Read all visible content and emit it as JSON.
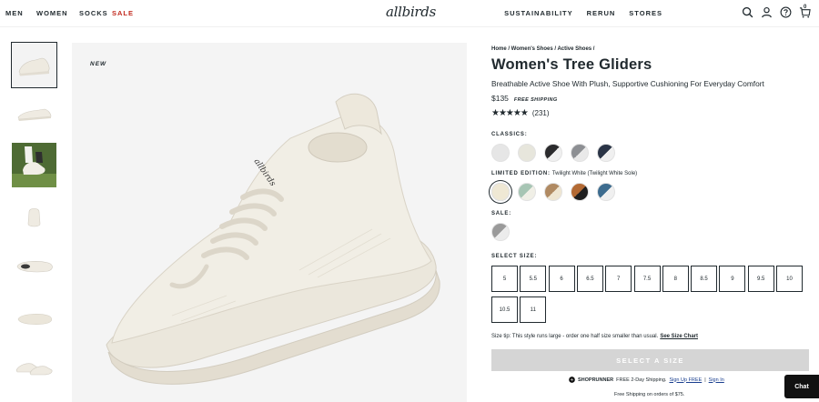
{
  "header": {
    "nav_left": [
      {
        "label": "MEN"
      },
      {
        "label": "WOMEN"
      },
      {
        "label": "SOCKS"
      },
      {
        "label": "SALE"
      }
    ],
    "logo": "allbirds",
    "nav_right": [
      {
        "label": "SUSTAINABILITY"
      },
      {
        "label": "RERUN"
      },
      {
        "label": "STORES"
      }
    ],
    "icons": [
      "search-icon",
      "account-icon",
      "help-icon",
      "cart-icon"
    ],
    "cart_count": "0"
  },
  "gallery": {
    "badge": "NEW",
    "thumbnail_count": 7
  },
  "product": {
    "breadcrumb": "Home / Women's Shoes / Active Shoes /",
    "title": "Women's Tree Gliders",
    "subtitle": "Breathable Active Shoe With Plush, Supportive Cushioning For Everyday Comfort",
    "price": "$135",
    "shipping_badge": "FREE SHIPPING",
    "rating_stars": 4.5,
    "review_count": "(231)"
  },
  "colors": {
    "classics_label": "CLASSICS:",
    "classics": [
      {
        "name": "light-grey",
        "left": "#e6e6e6",
        "right": "#e6e6e6"
      },
      {
        "name": "cream",
        "left": "#e7e6dc",
        "right": "#e7e6dc"
      },
      {
        "name": "black-white",
        "left": "#2b2b2d",
        "right": "#f0f0f0"
      },
      {
        "name": "grey-white",
        "left": "#8d8f93",
        "right": "#e9e9e9"
      },
      {
        "name": "navy-white",
        "left": "#2a3446",
        "right": "#f0f0f0"
      }
    ],
    "limited_label": "LIMITED EDITION:",
    "limited_value": "Twilight White (Twilight White Sole)",
    "limited": [
      {
        "name": "twilight-white",
        "left": "#efe8d4",
        "right": "#efe8d4",
        "selected": true
      },
      {
        "name": "mint-white",
        "left": "#a7c5b4",
        "right": "#f0efe6"
      },
      {
        "name": "tan-cream",
        "left": "#b08a62",
        "right": "#efe6d2"
      },
      {
        "name": "brown-black",
        "left": "#b36a34",
        "right": "#1f1f1f"
      },
      {
        "name": "blue-white",
        "left": "#3d6c8f",
        "right": "#f0f0f0"
      }
    ],
    "sale_label": "SALE:",
    "sale": [
      {
        "name": "grey-white-sale",
        "left": "#9a9a9a",
        "right": "#ececec"
      }
    ]
  },
  "sizing": {
    "label": "SELECT SIZE:",
    "sizes": [
      "5",
      "5.5",
      "6",
      "6.5",
      "7",
      "7.5",
      "8",
      "8.5",
      "9",
      "9.5",
      "10",
      "10.5",
      "11"
    ],
    "tip": "Size tip: This style runs large - order one half size smaller than usual.",
    "chart_link": "See Size Chart",
    "button": "SELECT A SIZE"
  },
  "shoprunner": {
    "brand": "SHOPRUNNER",
    "text": "FREE 2-Day Shipping.",
    "signup": "Sign Up FREE",
    "sep": "|",
    "signin": "Sign In",
    "free_shipping": "Free Shipping on orders of $75."
  },
  "chat": {
    "label": "Chat"
  }
}
